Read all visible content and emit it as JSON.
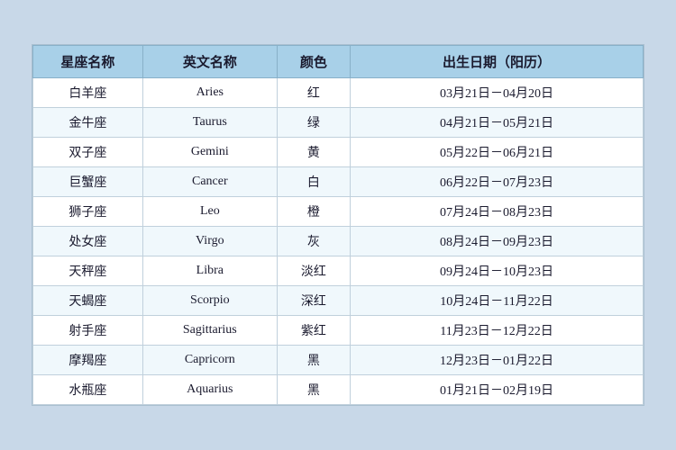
{
  "table": {
    "headers": {
      "chinese_name": "星座名称",
      "english_name": "英文名称",
      "color": "颜色",
      "birthdate": "出生日期（阳历）"
    },
    "rows": [
      {
        "chinese": "白羊座",
        "english": "Aries",
        "color": "红",
        "dates": "03月21日－04月20日"
      },
      {
        "chinese": "金牛座",
        "english": "Taurus",
        "color": "绿",
        "dates": "04月21日－05月21日"
      },
      {
        "chinese": "双子座",
        "english": "Gemini",
        "color": "黄",
        "dates": "05月22日－06月21日"
      },
      {
        "chinese": "巨蟹座",
        "english": "Cancer",
        "color": "白",
        "dates": "06月22日－07月23日"
      },
      {
        "chinese": "狮子座",
        "english": "Leo",
        "color": "橙",
        "dates": "07月24日－08月23日"
      },
      {
        "chinese": "处女座",
        "english": "Virgo",
        "color": "灰",
        "dates": "08月24日－09月23日"
      },
      {
        "chinese": "天秤座",
        "english": "Libra",
        "color": "淡红",
        "dates": "09月24日－10月23日"
      },
      {
        "chinese": "天蝎座",
        "english": "Scorpio",
        "color": "深红",
        "dates": "10月24日－11月22日"
      },
      {
        "chinese": "射手座",
        "english": "Sagittarius",
        "color": "紫红",
        "dates": "11月23日－12月22日"
      },
      {
        "chinese": "摩羯座",
        "english": "Capricorn",
        "color": "黑",
        "dates": "12月23日－01月22日"
      },
      {
        "chinese": "水瓶座",
        "english": "Aquarius",
        "color": "黑",
        "dates": "01月21日－02月19日"
      }
    ]
  }
}
